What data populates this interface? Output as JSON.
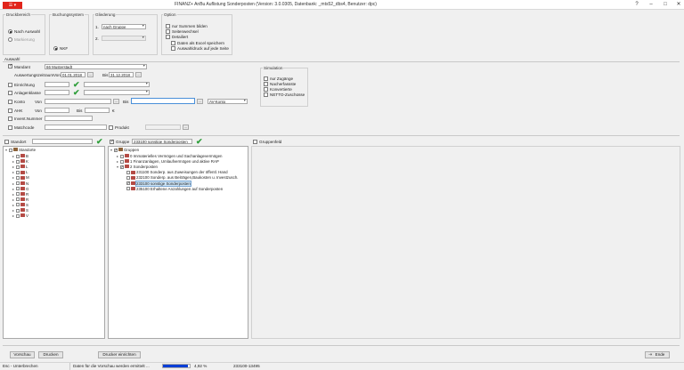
{
  "window": {
    "app_button": "☰ ▾",
    "title": "FINANZ+ AnBu Auflistung Sonderposten (Version: 3.0.0305, Datenbank:               _mts52_dbs4, Benutzer: dpc)",
    "help": "?",
    "minimize": "‒",
    "maximize": "□",
    "close": "✕"
  },
  "druckbereich": {
    "label": "Druckbereich",
    "options": [
      "Nach Auswahl",
      "Markierung"
    ],
    "selected": 0
  },
  "buchungssystem": {
    "label": "Buchungssystem",
    "option": "NKF",
    "selected": true
  },
  "gliederung": {
    "label": "Gliederung",
    "row1_num": "1.",
    "row1_value": "nach Gruppe",
    "row2_num": "2.",
    "row2_value": ""
  },
  "option": {
    "label": "Option",
    "items": [
      "nur Summen bilden",
      "Seitenwechsel",
      "Detailiert",
      "Daten als Excel speichern",
      "Auswahldruck auf jede Seite"
    ]
  },
  "auswahl": {
    "label": "Auswahl",
    "mandant_label": "Mandant",
    "mandant_value": "66 Musterstadt",
    "zeitraum_label": "Auswertungszeitraum",
    "von_label": "Von",
    "von_value": "01.01.2018",
    "bis_label": "Bis",
    "bis_value": "31.12.2018",
    "einrichtung_label": "Einrichtung",
    "anlagenklasse_label": "Anlagenklasse",
    "konto_label": "Konto",
    "konto_von": "Von",
    "konto_bis": "Bis",
    "konto_drop": "AV-Konto",
    "ahk_label": "AHK",
    "ahk_von": "Von",
    "ahk_bis": "Bis",
    "ahk_unit": "€",
    "invent_label": "Invent.Nummer",
    "matchcode_label": "Matchcode",
    "produkt_label": "Produkt"
  },
  "simulation": {
    "label": "Simulation",
    "items": [
      "nur Zugänge",
      "Nacherfassste",
      "Konvertierte",
      "NETTO-Zuschüsse"
    ]
  },
  "filterbar": {
    "standort_label": "Standort",
    "gruppe_label": "Gruppe",
    "gruppe_value": "233100 sonstige Sonderposten",
    "gruppenfeld_label": "Gruppenfeld"
  },
  "tree_left": {
    "root": "Standorte",
    "items": [
      "B",
      "K",
      "L",
      "L",
      "M",
      "N",
      "G",
      "R",
      "R",
      "S",
      "S",
      "V"
    ]
  },
  "tree_right": {
    "root": "Gruppen",
    "items": [
      {
        "label": "0 Immaterielles Vermögen und Sachanlagevermögen",
        "level": 1,
        "expanded": false,
        "checked": false
      },
      {
        "label": "1 Finanzanlagen, Umlaufvermögen und aktive RAP",
        "level": 1,
        "expanded": false,
        "checked": false
      },
      {
        "label": "2 Sonderposten",
        "level": 1,
        "expanded": true,
        "checked": true
      },
      {
        "label": "231100 Sonderp. aus Zuweisungen der öffentl. Hand",
        "level": 2,
        "expanded": false,
        "checked": false
      },
      {
        "label": "232100 Sonderp. aus Beiträgen,Baukosten u. Investzusch.",
        "level": 2,
        "expanded": false,
        "checked": false
      },
      {
        "label": "233100 sonstige Sonderposten",
        "level": 2,
        "expanded": false,
        "checked": true,
        "selected": true
      },
      {
        "label": "235100 Erhaltene Anzahlungen auf Sonderposten",
        "level": 2,
        "expanded": false,
        "checked": false
      }
    ]
  },
  "buttons": {
    "vorschau": "Vorschau",
    "drucken": "Drucken",
    "drucker": "Drucker einrichten",
    "ende": "Ende"
  },
  "status": {
    "esc_text": "Esc - Unterbrechen",
    "message": "Daten für die Vorschau werden ermittelt ...",
    "progress": 0.92,
    "progress_text": "4,92 %",
    "code": "233100-13495"
  },
  "colors": {
    "accent_red": "#e1251b",
    "check_green": "#2e9e3a",
    "progress_blue": "#0b3fd6"
  }
}
